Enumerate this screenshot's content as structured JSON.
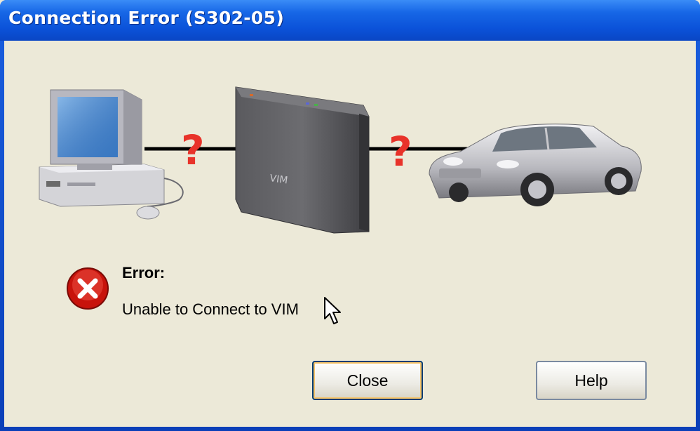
{
  "window": {
    "title": "Connection Error (S302-05)"
  },
  "diagram": {
    "computer_icon": "desktop-computer",
    "device_icon": "vim-interface-box",
    "device_label": "VIM",
    "vehicle_icon": "car",
    "link1_status": "?",
    "link2_status": "?",
    "question_color": "#e8332a"
  },
  "message": {
    "icon": "error-icon",
    "title": "Error:",
    "text": "Unable to Connect to VIM"
  },
  "buttons": {
    "close_label": "Close",
    "help_label": "Help"
  }
}
